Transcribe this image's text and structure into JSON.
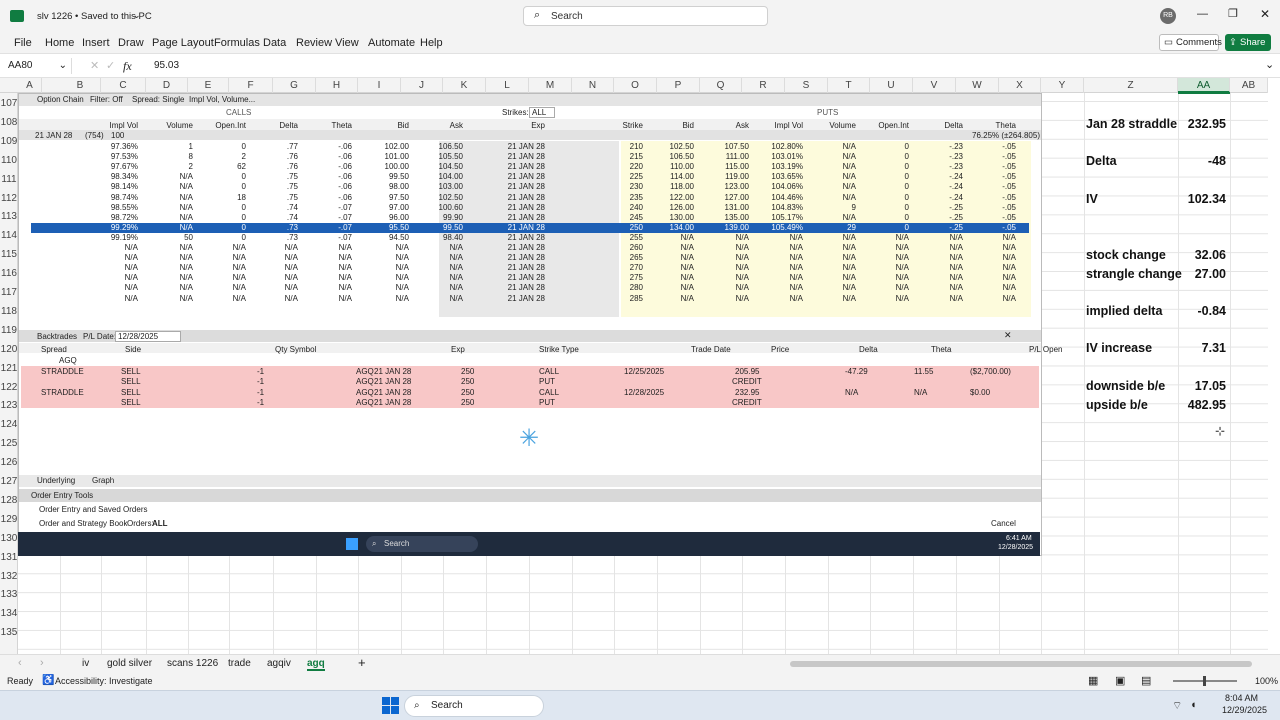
{
  "window": {
    "title": "slv 1226 • Saved to this PC",
    "search_placeholder": "Search",
    "avatar": "RB"
  },
  "ribbon": {
    "tabs": [
      "File",
      "Home",
      "Insert",
      "Draw",
      "Page Layout",
      "Formulas",
      "Data",
      "Review",
      "View",
      "Automate",
      "Help"
    ],
    "comments": "Comments",
    "share": "Share"
  },
  "formula_bar": {
    "name_box": "AA80",
    "fx": "fx",
    "value": "95.03"
  },
  "columns": [
    "A",
    "B",
    "C",
    "D",
    "E",
    "F",
    "G",
    "H",
    "I",
    "J",
    "K",
    "L",
    "M",
    "N",
    "O",
    "P",
    "Q",
    "R",
    "S",
    "T",
    "U",
    "V",
    "W",
    "X",
    "Y",
    "Z",
    "AA",
    "AB"
  ],
  "rows": [
    "107",
    "108",
    "109",
    "110",
    "111",
    "112",
    "113",
    "114",
    "115",
    "116",
    "117",
    "118",
    "119",
    "120",
    "121",
    "122",
    "123",
    "124",
    "125",
    "126",
    "127",
    "128",
    "129",
    "130",
    "131",
    "132",
    "133",
    "134",
    "135"
  ],
  "tos": {
    "option_chain": "Option Chain",
    "filter": "Filter: Off",
    "spread": "Spread: Single",
    "impl": "Impl Vol, Volume...",
    "calls": "CALLS",
    "puts": "PUTS",
    "strikes_label": "Strikes:",
    "strikes_value": "ALL",
    "exp_group": "21 JAN 28",
    "exp_count": "(754)",
    "exp_mult": "100",
    "puts_note": "76.25% (±264.805)",
    "calls_headers": [
      "Impl Vol",
      "Volume",
      "Open.Int",
      "Delta",
      "Theta",
      "Bid",
      "Ask"
    ],
    "mid_headers": [
      "Exp",
      "Strike"
    ],
    "puts_headers": [
      "Bid",
      "Ask",
      "Impl Vol",
      "Volume",
      "Open.Int",
      "Delta",
      "Theta"
    ],
    "chain_rows": [
      {
        "c": [
          "97.36%",
          "1",
          "0",
          ".77",
          "-.06",
          "102.00",
          "106.50"
        ],
        "exp": "21 JAN 28",
        "k": "210",
        "p": [
          "102.50",
          "107.50",
          "102.80%",
          "N/A",
          "0",
          "-.23",
          "-.05"
        ]
      },
      {
        "c": [
          "97.53%",
          "8",
          "2",
          ".76",
          "-.06",
          "101.00",
          "105.50"
        ],
        "exp": "21 JAN 28",
        "k": "215",
        "p": [
          "106.50",
          "111.00",
          "103.01%",
          "N/A",
          "0",
          "-.23",
          "-.05"
        ]
      },
      {
        "c": [
          "97.67%",
          "2",
          "62",
          ".76",
          "-.06",
          "100.00",
          "104.50"
        ],
        "exp": "21 JAN 28",
        "k": "220",
        "p": [
          "110.00",
          "115.00",
          "103.19%",
          "N/A",
          "0",
          "-.23",
          "-.05"
        ]
      },
      {
        "c": [
          "98.34%",
          "N/A",
          "0",
          ".75",
          "-.06",
          "99.50",
          "104.00"
        ],
        "exp": "21 JAN 28",
        "k": "225",
        "p": [
          "114.00",
          "119.00",
          "103.65%",
          "N/A",
          "0",
          "-.24",
          "-.05"
        ]
      },
      {
        "c": [
          "98.14%",
          "N/A",
          "0",
          ".75",
          "-.06",
          "98.00",
          "103.00"
        ],
        "exp": "21 JAN 28",
        "k": "230",
        "p": [
          "118.00",
          "123.00",
          "104.06%",
          "N/A",
          "0",
          "-.24",
          "-.05"
        ]
      },
      {
        "c": [
          "98.74%",
          "N/A",
          "18",
          ".75",
          "-.06",
          "97.50",
          "102.50"
        ],
        "exp": "21 JAN 28",
        "k": "235",
        "p": [
          "122.00",
          "127.00",
          "104.46%",
          "N/A",
          "0",
          "-.24",
          "-.05"
        ]
      },
      {
        "c": [
          "98.55%",
          "N/A",
          "0",
          ".74",
          "-.07",
          "97.00",
          "100.60"
        ],
        "exp": "21 JAN 28",
        "k": "240",
        "p": [
          "126.00",
          "131.00",
          "104.83%",
          "9",
          "0",
          "-.25",
          "-.05"
        ]
      },
      {
        "c": [
          "98.72%",
          "N/A",
          "0",
          ".74",
          "-.07",
          "96.00",
          "99.90"
        ],
        "exp": "21 JAN 28",
        "k": "245",
        "p": [
          "130.00",
          "135.00",
          "105.17%",
          "N/A",
          "0",
          "-.25",
          "-.05"
        ]
      },
      {
        "c": [
          "99.29%",
          "N/A",
          "0",
          ".73",
          "-.07",
          "95.50",
          "99.50"
        ],
        "exp": "21 JAN 28",
        "k": "250",
        "p": [
          "134.00",
          "139.00",
          "105.49%",
          "29",
          "0",
          "-.25",
          "-.05"
        ],
        "sel": true
      },
      {
        "c": [
          "99.19%",
          "50",
          "0",
          ".73",
          "-.07",
          "94.50",
          "98.40"
        ],
        "exp": "21 JAN 28",
        "k": "255",
        "p": [
          "N/A",
          "N/A",
          "N/A",
          "N/A",
          "N/A",
          "N/A",
          "N/A"
        ]
      },
      {
        "c": [
          "N/A",
          "N/A",
          "N/A",
          "N/A",
          "N/A",
          "N/A",
          "N/A"
        ],
        "exp": "21 JAN 28",
        "k": "260",
        "p": [
          "N/A",
          "N/A",
          "N/A",
          "N/A",
          "N/A",
          "N/A",
          "N/A"
        ]
      },
      {
        "c": [
          "N/A",
          "N/A",
          "N/A",
          "N/A",
          "N/A",
          "N/A",
          "N/A"
        ],
        "exp": "21 JAN 28",
        "k": "265",
        "p": [
          "N/A",
          "N/A",
          "N/A",
          "N/A",
          "N/A",
          "N/A",
          "N/A"
        ]
      },
      {
        "c": [
          "N/A",
          "N/A",
          "N/A",
          "N/A",
          "N/A",
          "N/A",
          "N/A"
        ],
        "exp": "21 JAN 28",
        "k": "270",
        "p": [
          "N/A",
          "N/A",
          "N/A",
          "N/A",
          "N/A",
          "N/A",
          "N/A"
        ]
      },
      {
        "c": [
          "N/A",
          "N/A",
          "N/A",
          "N/A",
          "N/A",
          "N/A",
          "N/A"
        ],
        "exp": "21 JAN 28",
        "k": "275",
        "p": [
          "N/A",
          "N/A",
          "N/A",
          "N/A",
          "N/A",
          "N/A",
          "N/A"
        ]
      },
      {
        "c": [
          "N/A",
          "N/A",
          "N/A",
          "N/A",
          "N/A",
          "N/A",
          "N/A"
        ],
        "exp": "21 JAN 28",
        "k": "280",
        "p": [
          "N/A",
          "N/A",
          "N/A",
          "N/A",
          "N/A",
          "N/A",
          "N/A"
        ]
      },
      {
        "c": [
          "N/A",
          "N/A",
          "N/A",
          "N/A",
          "N/A",
          "N/A",
          "N/A"
        ],
        "exp": "21 JAN 28",
        "k": "285",
        "p": [
          "N/A",
          "N/A",
          "N/A",
          "N/A",
          "N/A",
          "N/A",
          "N/A"
        ]
      }
    ],
    "backtrades": "Backtrades",
    "pl_date_label": "P/L Date:",
    "pl_date": "12/28/2025",
    "bt_headers": [
      "Spread",
      "Side",
      "Qty Symbol",
      "Exp",
      "Strike Type",
      "Trade Date",
      "Price",
      "Delta",
      "Theta",
      "P/L Open"
    ],
    "bt_group": "AGQ",
    "bt_rows": [
      {
        "spread": "STRADDLE",
        "side1": "SELL",
        "side2": "SELL",
        "qty1": "-1",
        "qty2": "-1",
        "sym1": "AGQ",
        "sym2": "AGQ",
        "exp1": "21 JAN 28",
        "exp2": "21 JAN 28",
        "k1": "250",
        "k2": "250",
        "t1": "CALL",
        "t2": "PUT",
        "date": "12/25/2025",
        "price": "205.95",
        "credit": "CREDIT",
        "delta": "-47.29",
        "theta": "11.55",
        "pl": "($2,700.00)"
      },
      {
        "spread": "STRADDLE",
        "side1": "SELL",
        "side2": "SELL",
        "qty1": "-1",
        "qty2": "-1",
        "sym1": "AGQ",
        "sym2": "AGQ",
        "exp1": "21 JAN 28",
        "exp2": "21 JAN 28",
        "k1": "250",
        "k2": "250",
        "t1": "CALL",
        "t2": "PUT",
        "date": "12/28/2025",
        "price": "232.95",
        "credit": "CREDIT",
        "delta": "N/A",
        "theta": "N/A",
        "pl": "$0.00"
      }
    ],
    "underlying": "Underlying",
    "graph": "Graph",
    "order_entry_tools": "Order Entry Tools",
    "order_entry_saved": "Order Entry and Saved Orders",
    "order_strategy": "Order and Strategy Book",
    "orders_label": "Orders:",
    "orders_value": "ALL",
    "cancel": "Cancel",
    "inner_search": "Search",
    "inner_time": "6:41 AM",
    "inner_date": "12/28/2025"
  },
  "summary": [
    {
      "label": "Jan 28 straddle",
      "value": "232.95"
    },
    {
      "label": "Delta",
      "value": "-48"
    },
    {
      "label": "IV",
      "value": "102.34"
    },
    {
      "label": "stock change",
      "value": "32.06"
    },
    {
      "label": "strangle change",
      "value": "27.00"
    },
    {
      "label": "implied delta",
      "value": "-0.84"
    },
    {
      "label": "IV increase",
      "value": "7.31"
    },
    {
      "label": "downside b/e",
      "value": "17.05"
    },
    {
      "label": "upside b/e",
      "value": "482.95"
    }
  ],
  "sheet_tabs": [
    "iv",
    "gold silver",
    "scans 1226",
    "trade",
    "agqiv",
    "agq"
  ],
  "active_sheet": "agq",
  "status": {
    "ready": "Ready",
    "accessibility": "Accessibility: Investigate",
    "zoom": "100%"
  },
  "taskbar": {
    "search": "Search",
    "time": "8:04 AM",
    "date": "12/29/2025"
  }
}
